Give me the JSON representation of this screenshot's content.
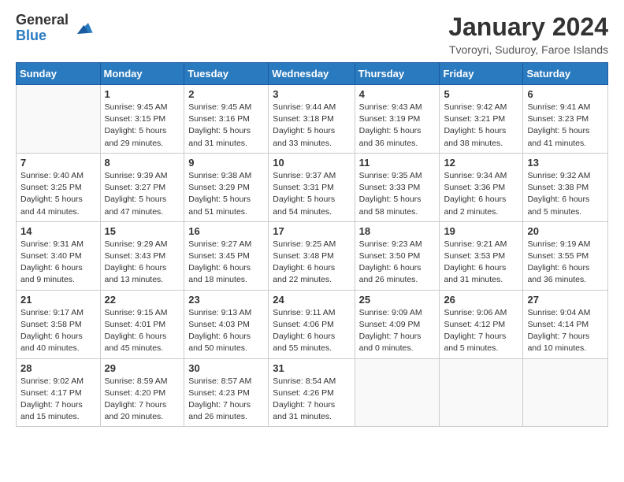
{
  "logo": {
    "general": "General",
    "blue": "Blue"
  },
  "title": "January 2024",
  "subtitle": "Tvoroyri, Suduroy, Faroe Islands",
  "days_of_week": [
    "Sunday",
    "Monday",
    "Tuesday",
    "Wednesday",
    "Thursday",
    "Friday",
    "Saturday"
  ],
  "weeks": [
    [
      {
        "day": "",
        "info": ""
      },
      {
        "day": "1",
        "info": "Sunrise: 9:45 AM\nSunset: 3:15 PM\nDaylight: 5 hours\nand 29 minutes."
      },
      {
        "day": "2",
        "info": "Sunrise: 9:45 AM\nSunset: 3:16 PM\nDaylight: 5 hours\nand 31 minutes."
      },
      {
        "day": "3",
        "info": "Sunrise: 9:44 AM\nSunset: 3:18 PM\nDaylight: 5 hours\nand 33 minutes."
      },
      {
        "day": "4",
        "info": "Sunrise: 9:43 AM\nSunset: 3:19 PM\nDaylight: 5 hours\nand 36 minutes."
      },
      {
        "day": "5",
        "info": "Sunrise: 9:42 AM\nSunset: 3:21 PM\nDaylight: 5 hours\nand 38 minutes."
      },
      {
        "day": "6",
        "info": "Sunrise: 9:41 AM\nSunset: 3:23 PM\nDaylight: 5 hours\nand 41 minutes."
      }
    ],
    [
      {
        "day": "7",
        "info": "Sunrise: 9:40 AM\nSunset: 3:25 PM\nDaylight: 5 hours\nand 44 minutes."
      },
      {
        "day": "8",
        "info": "Sunrise: 9:39 AM\nSunset: 3:27 PM\nDaylight: 5 hours\nand 47 minutes."
      },
      {
        "day": "9",
        "info": "Sunrise: 9:38 AM\nSunset: 3:29 PM\nDaylight: 5 hours\nand 51 minutes."
      },
      {
        "day": "10",
        "info": "Sunrise: 9:37 AM\nSunset: 3:31 PM\nDaylight: 5 hours\nand 54 minutes."
      },
      {
        "day": "11",
        "info": "Sunrise: 9:35 AM\nSunset: 3:33 PM\nDaylight: 5 hours\nand 58 minutes."
      },
      {
        "day": "12",
        "info": "Sunrise: 9:34 AM\nSunset: 3:36 PM\nDaylight: 6 hours\nand 2 minutes."
      },
      {
        "day": "13",
        "info": "Sunrise: 9:32 AM\nSunset: 3:38 PM\nDaylight: 6 hours\nand 5 minutes."
      }
    ],
    [
      {
        "day": "14",
        "info": "Sunrise: 9:31 AM\nSunset: 3:40 PM\nDaylight: 6 hours\nand 9 minutes."
      },
      {
        "day": "15",
        "info": "Sunrise: 9:29 AM\nSunset: 3:43 PM\nDaylight: 6 hours\nand 13 minutes."
      },
      {
        "day": "16",
        "info": "Sunrise: 9:27 AM\nSunset: 3:45 PM\nDaylight: 6 hours\nand 18 minutes."
      },
      {
        "day": "17",
        "info": "Sunrise: 9:25 AM\nSunset: 3:48 PM\nDaylight: 6 hours\nand 22 minutes."
      },
      {
        "day": "18",
        "info": "Sunrise: 9:23 AM\nSunset: 3:50 PM\nDaylight: 6 hours\nand 26 minutes."
      },
      {
        "day": "19",
        "info": "Sunrise: 9:21 AM\nSunset: 3:53 PM\nDaylight: 6 hours\nand 31 minutes."
      },
      {
        "day": "20",
        "info": "Sunrise: 9:19 AM\nSunset: 3:55 PM\nDaylight: 6 hours\nand 36 minutes."
      }
    ],
    [
      {
        "day": "21",
        "info": "Sunrise: 9:17 AM\nSunset: 3:58 PM\nDaylight: 6 hours\nand 40 minutes."
      },
      {
        "day": "22",
        "info": "Sunrise: 9:15 AM\nSunset: 4:01 PM\nDaylight: 6 hours\nand 45 minutes."
      },
      {
        "day": "23",
        "info": "Sunrise: 9:13 AM\nSunset: 4:03 PM\nDaylight: 6 hours\nand 50 minutes."
      },
      {
        "day": "24",
        "info": "Sunrise: 9:11 AM\nSunset: 4:06 PM\nDaylight: 6 hours\nand 55 minutes."
      },
      {
        "day": "25",
        "info": "Sunrise: 9:09 AM\nSunset: 4:09 PM\nDaylight: 7 hours\nand 0 minutes."
      },
      {
        "day": "26",
        "info": "Sunrise: 9:06 AM\nSunset: 4:12 PM\nDaylight: 7 hours\nand 5 minutes."
      },
      {
        "day": "27",
        "info": "Sunrise: 9:04 AM\nSunset: 4:14 PM\nDaylight: 7 hours\nand 10 minutes."
      }
    ],
    [
      {
        "day": "28",
        "info": "Sunrise: 9:02 AM\nSunset: 4:17 PM\nDaylight: 7 hours\nand 15 minutes."
      },
      {
        "day": "29",
        "info": "Sunrise: 8:59 AM\nSunset: 4:20 PM\nDaylight: 7 hours\nand 20 minutes."
      },
      {
        "day": "30",
        "info": "Sunrise: 8:57 AM\nSunset: 4:23 PM\nDaylight: 7 hours\nand 26 minutes."
      },
      {
        "day": "31",
        "info": "Sunrise: 8:54 AM\nSunset: 4:26 PM\nDaylight: 7 hours\nand 31 minutes."
      },
      {
        "day": "",
        "info": ""
      },
      {
        "day": "",
        "info": ""
      },
      {
        "day": "",
        "info": ""
      }
    ]
  ]
}
